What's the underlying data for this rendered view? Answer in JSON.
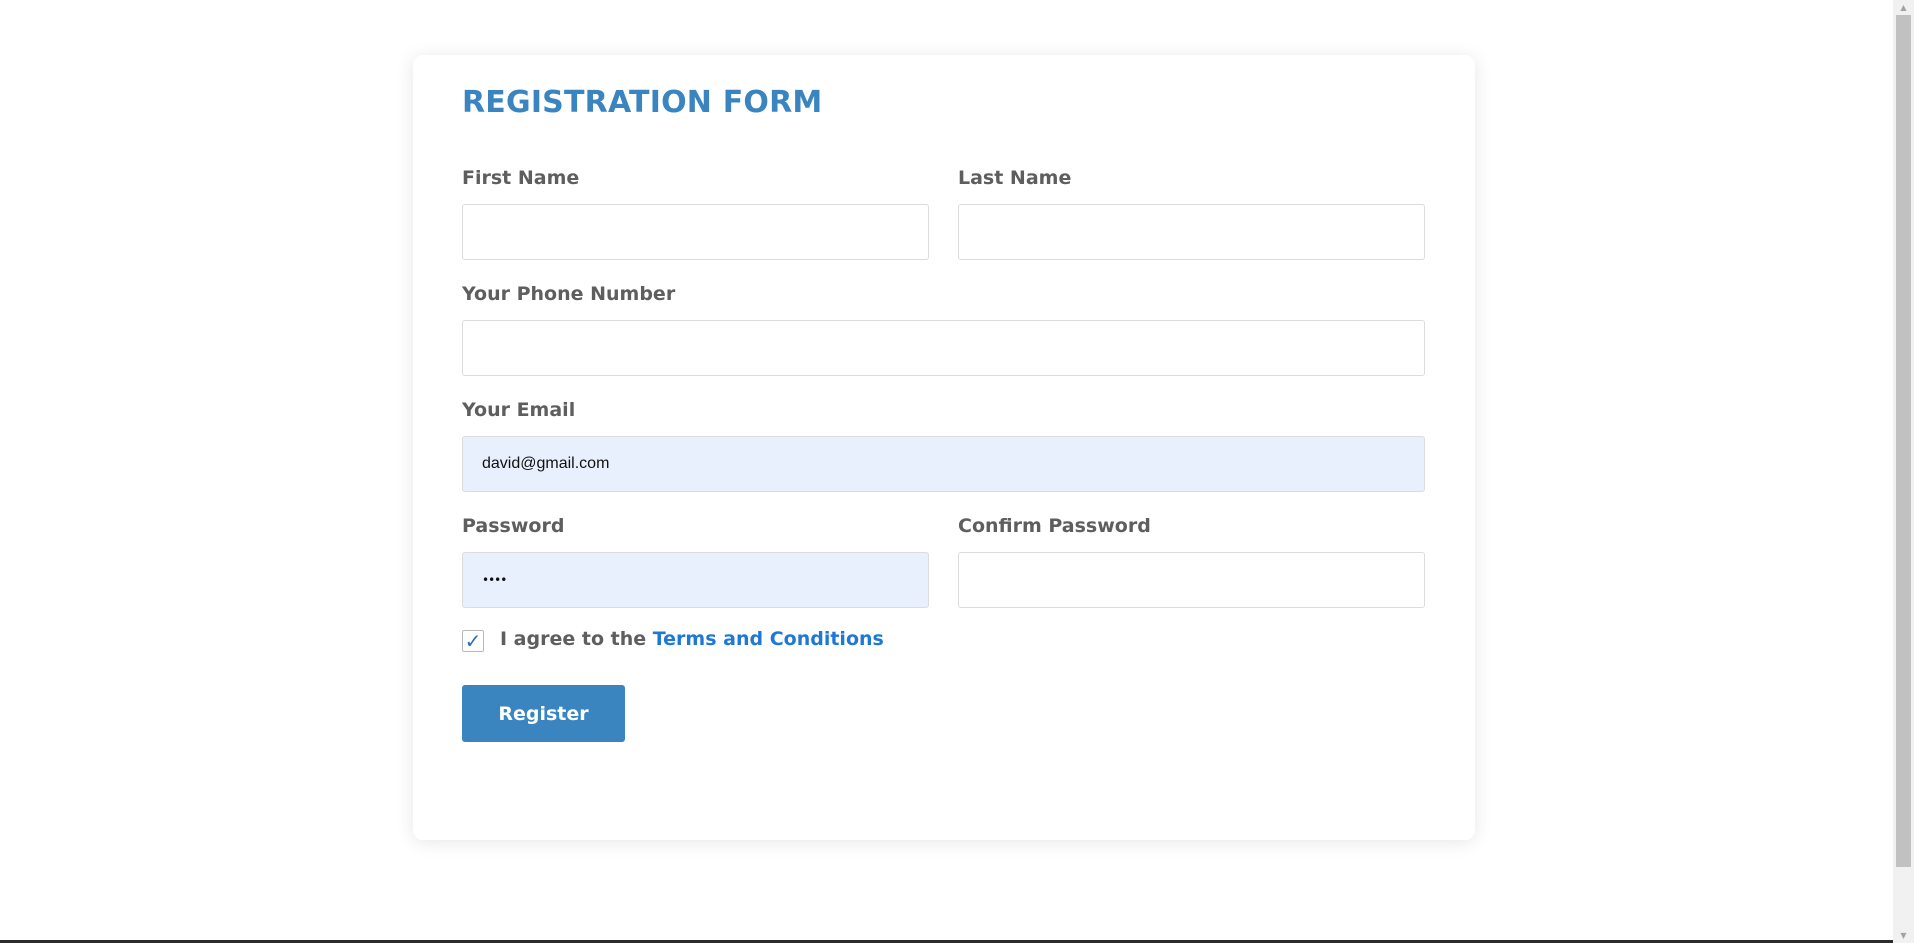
{
  "form": {
    "title": "REGISTRATION FORM",
    "first_name": {
      "label": "First Name",
      "value": ""
    },
    "last_name": {
      "label": "Last Name",
      "value": ""
    },
    "phone": {
      "label": "Your Phone Number",
      "value": ""
    },
    "email": {
      "label": "Your Email",
      "value": "david@gmail.com"
    },
    "password": {
      "label": "Password",
      "masked_value": "••••"
    },
    "confirm_password": {
      "label": "Confirm Password",
      "value": ""
    },
    "agree": {
      "checked": true,
      "checkmark": "✓",
      "text": "I agree to the",
      "link_text": "Terms and Conditions"
    },
    "register_label": "Register"
  },
  "colors": {
    "accent": "#3a85c0",
    "link": "#1f78d6",
    "label_text": "#5e5e5e",
    "autofill_bg": "#e8f0fe"
  },
  "icons": {
    "scroll_up": "scroll-up-arrow-icon",
    "scroll_down": "scroll-down-arrow-icon",
    "checkmark": "checkmark-icon"
  }
}
